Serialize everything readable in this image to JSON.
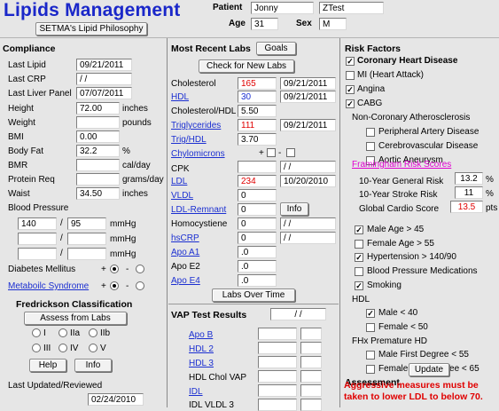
{
  "app": {
    "title": "Lipids Management"
  },
  "patient": {
    "label_patient": "Patient",
    "first_name": "Jonny",
    "last_name": "ZTest",
    "label_age": "Age",
    "age": "31",
    "label_sex": "Sex",
    "sex": "M"
  },
  "compliance": {
    "philosophy_button": "SETMA's Lipid Philosophy",
    "heading": "Compliance",
    "last_lipid_label": "Last Lipid",
    "last_lipid": "09/21/2011",
    "last_crp_label": "Last CRP",
    "last_crp": " / /",
    "last_liver_label": "Last Liver Panel",
    "last_liver": "07/07/2011",
    "height_label": "Height",
    "height": "72.00",
    "height_unit": "inches",
    "weight_label": "Weight",
    "weight": "",
    "weight_unit": "pounds",
    "bmi_label": "BMI",
    "bmi": "0.00",
    "bodyfat_label": "Body Fat",
    "bodyfat": "32.2",
    "bodyfat_unit": "%",
    "bmr_label": "BMR",
    "bmr": "",
    "bmr_unit": "cal/day",
    "protein_label": "Protein Req",
    "protein": "",
    "protein_unit": "grams/day",
    "waist_label": "Waist",
    "waist": "34.50",
    "waist_unit": "inches",
    "bp_label": "Blood Pressure",
    "bp": [
      {
        "sys": "140",
        "dia": "95"
      },
      {
        "sys": "",
        "dia": ""
      },
      {
        "sys": "",
        "dia": ""
      }
    ],
    "bp_slash": "/",
    "bp_unit": "mmHg",
    "diabetes_label": "Diabetes Mellitus",
    "plus": "+",
    "minus": "-",
    "metabolic_label": "Metaboilc Syndrome",
    "fredrickson_heading": "Fredrickson Classification",
    "assess_button": "Assess from Labs",
    "types": [
      "I",
      "IIa",
      "IIb",
      "III",
      "IV",
      "V"
    ],
    "help_button": "Help",
    "info_button": "Info",
    "updated_label": "Last Updated/Reviewed",
    "updated": "02/24/2010"
  },
  "labs": {
    "heading": "Most Recent Labs",
    "goals_button": "Goals",
    "check_button": "Check for New Labs",
    "rows": [
      {
        "label": "Cholesterol",
        "value": "165",
        "date": "09/21/2011"
      },
      {
        "label": "HDL",
        "value": "30",
        "date": "09/21/2011"
      },
      {
        "label": "Cholesterol/HDL",
        "value": "5.50",
        "date": ""
      },
      {
        "label": "Triglycerides",
        "value": "111",
        "date": "09/21/2011"
      },
      {
        "label": "Trig/HDL",
        "value": "3.70",
        "date": ""
      },
      {
        "label": "Chylomicrons",
        "value": "",
        "date": ""
      },
      {
        "label": "CPK",
        "value": "",
        "date": " / /"
      },
      {
        "label": "LDL",
        "value": "234",
        "date": "10/20/2010"
      },
      {
        "label": "VLDL",
        "value": "0",
        "date": ""
      },
      {
        "label": "LDL-Remnant",
        "value": "0",
        "date": ""
      },
      {
        "label": "Homocystiene",
        "value": "0",
        "date": " / /"
      },
      {
        "label": "hsCRP",
        "value": "0",
        "date": " / /"
      },
      {
        "label": "Apo A1",
        "value": ".0",
        "date": ""
      },
      {
        "label": "Apo E2",
        "value": ".0",
        "date": ""
      },
      {
        "label": "Apo E4",
        "value": ".0",
        "date": ""
      }
    ],
    "chylo_plus": "+",
    "chylo_minus": "-",
    "info_button": "Info",
    "labs_over_time_button": "Labs Over Time",
    "vap_heading": "VAP Test Results",
    "vap_date": " / /",
    "vap_rows": [
      "Apo B",
      "HDL 2",
      "HDL 3",
      "HDL Chol VAP",
      "IDL",
      "IDL VLDL 3"
    ]
  },
  "risk": {
    "heading": "Risk Factors",
    "items": [
      {
        "label": "Coronary Heart Disease",
        "checked": true,
        "bold": true
      },
      {
        "label": "MI (Heart Attack)",
        "checked": false
      },
      {
        "label": "Angina",
        "checked": true
      },
      {
        "label": "CABG",
        "checked": true
      }
    ],
    "noncoronary_label": "Non-Coronary Atherosclerosis",
    "noncoronary": [
      "Peripheral Artery Disease",
      "Cerebrovascular Disease",
      "Aortic Aneurysm"
    ],
    "framingham_link": "Framingham Risk Scores",
    "general_label": "10-Year General Risk",
    "general": "13.2",
    "general_unit": "%",
    "stroke_label": "10-Year Stroke Risk",
    "stroke": "11",
    "stroke_unit": "%",
    "cardio_label": "Global Cardio Score",
    "cardio": "13.5",
    "cardio_unit": "pts",
    "factors": [
      {
        "label": "Male Age > 45",
        "checked": true
      },
      {
        "label": "Female Age > 55",
        "checked": false
      },
      {
        "label": "Hypertension > 140/90",
        "checked": true
      },
      {
        "label": "Blood Pressure Medications",
        "checked": false
      },
      {
        "label": "Smoking",
        "checked": true
      }
    ],
    "hdl_label": "HDL",
    "hdl_items": [
      {
        "label": "Male < 40",
        "checked": true
      },
      {
        "label": "Female < 50",
        "checked": false
      }
    ],
    "fhx_label": "FHx Premature HD",
    "fhx_items": [
      {
        "label": "Male First Degree < 55",
        "checked": false
      },
      {
        "label": "Female First Degree < 65",
        "checked": false
      }
    ],
    "assessment_label": "Assessment",
    "update_button": "Update",
    "assessment_note": "Aggressive measures must be taken to lower LDL to below 70."
  },
  "colors": {
    "title": "#1a27c9",
    "link": "#1b2fd1",
    "alert": "#e00000",
    "framingham": "#e000d0",
    "background": "#e6e6e6"
  },
  "icons": {
    "check": "check-mark-icon",
    "radio": "radio-icon"
  }
}
